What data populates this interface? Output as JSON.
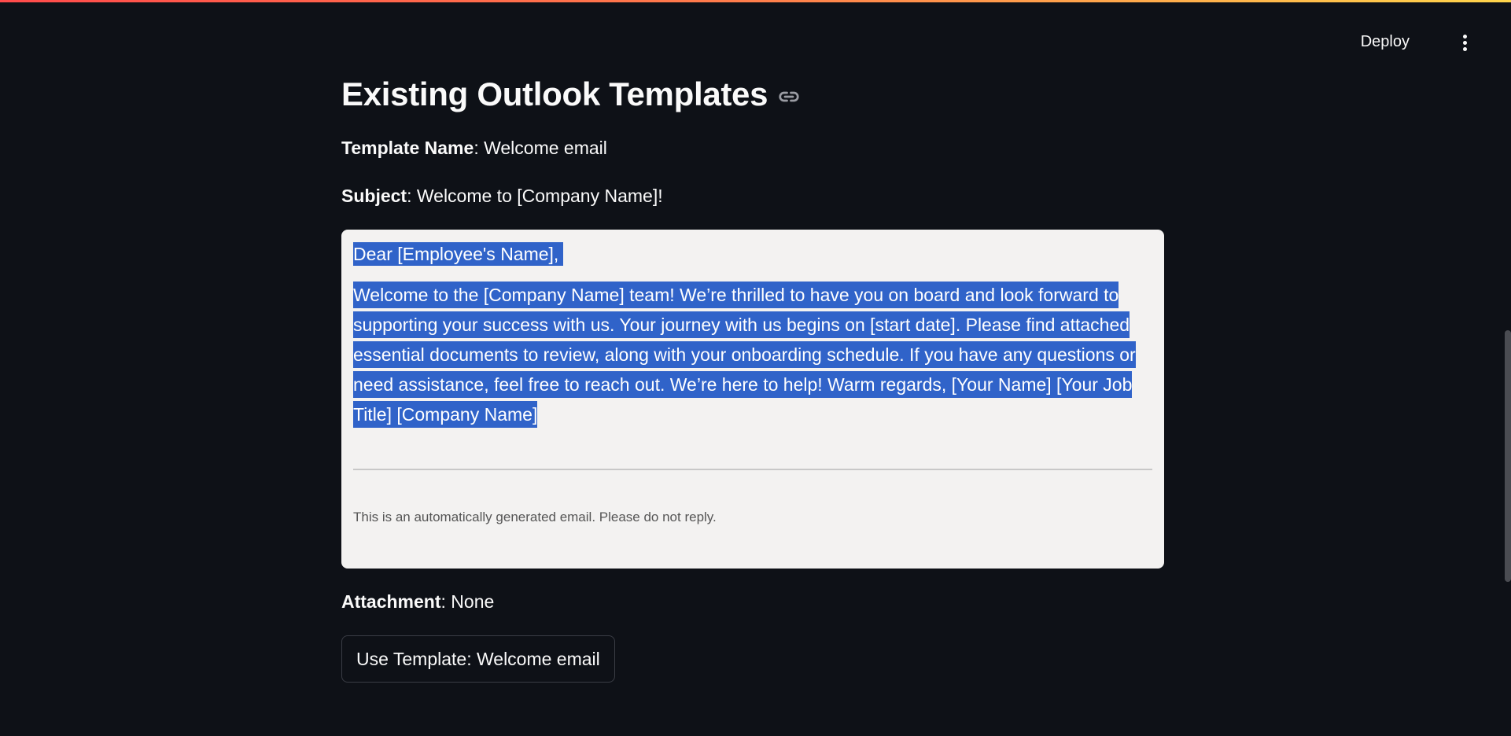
{
  "header": {
    "deploy_label": "Deploy",
    "menu_icon": "kebab-vertical-icon"
  },
  "main": {
    "title": "Existing Outlook Templates",
    "title_icon": "link-icon",
    "template_name_label": "Template Name",
    "template_name_value": "Welcome email",
    "subject_label": "Subject",
    "subject_value": "Welcome to [Company Name]!",
    "email": {
      "greeting": "Dear [Employee's Name],",
      "body": "Welcome to the [Company Name] team! We’re thrilled to have you on board and look forward to supporting your success with us. Your journey with us begins on [start date]. Please find attached essential documents to review, along with your onboarding schedule. If you have any questions or need assistance, feel free to reach out. We’re here to help! Warm regards, [Your Name] [Your Job Title] [Company Name]",
      "footer": "This is an automatically generated email. Please do not reply."
    },
    "attachment_label": "Attachment",
    "attachment_value": "None",
    "use_template_button": "Use Template: Welcome email"
  },
  "colors": {
    "background": "#0e1117",
    "selection": "#3063c9",
    "email_bg": "#f3f2f1"
  }
}
